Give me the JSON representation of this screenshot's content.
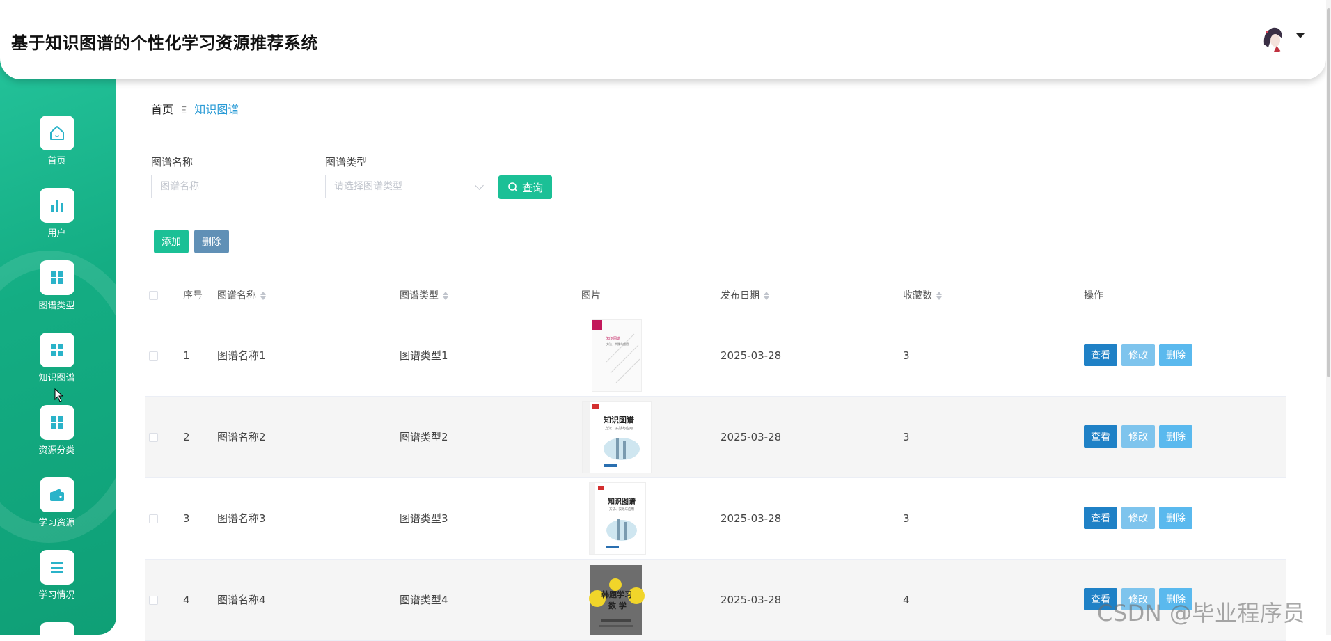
{
  "app": {
    "title": "基于知识图谱的个性化学习资源推荐系统"
  },
  "sidebar": {
    "items": [
      {
        "label": "首页",
        "icon": "home-icon"
      },
      {
        "label": "用户",
        "icon": "bar-chart-icon"
      },
      {
        "label": "图谱类型",
        "icon": "grid-icon"
      },
      {
        "label": "知识图谱",
        "icon": "grid-icon"
      },
      {
        "label": "资源分类",
        "icon": "grid-icon"
      },
      {
        "label": "学习资源",
        "icon": "wallet-icon"
      },
      {
        "label": "学习情况",
        "icon": "list-icon"
      }
    ]
  },
  "breadcrumb": {
    "home": "首页",
    "separator": "Ξ",
    "current": "知识图谱"
  },
  "filters": {
    "name_label": "图谱名称",
    "name_placeholder": "图谱名称",
    "type_label": "图谱类型",
    "type_placeholder": "请选择图谱类型",
    "query_label": "查询"
  },
  "toolbar": {
    "add_label": "添加",
    "delete_label": "删除"
  },
  "table": {
    "columns": {
      "index": "序号",
      "name": "图谱名称",
      "type": "图谱类型",
      "image": "图片",
      "date": "发布日期",
      "favorites": "收藏数",
      "actions": "操作"
    },
    "actions": {
      "view": "查看",
      "edit": "修改",
      "delete": "删除"
    },
    "rows": [
      {
        "index": "1",
        "name": "图谱名称1",
        "type": "图谱类型1",
        "date": "2025-03-28",
        "favorites": "3",
        "cover": "knowledge-graph-book-cover"
      },
      {
        "index": "2",
        "name": "图谱名称2",
        "type": "图谱类型2",
        "date": "2025-03-28",
        "favorites": "3",
        "cover": "knowledge-graph-book-cover"
      },
      {
        "index": "3",
        "name": "图谱名称3",
        "type": "图谱类型3",
        "date": "2025-03-28",
        "favorites": "3",
        "cover": "knowledge-graph-book-cover"
      },
      {
        "index": "4",
        "name": "图谱名称4",
        "type": "图谱类型4",
        "date": "2025-03-28",
        "favorites": "4",
        "cover": "math-book-cover"
      }
    ]
  },
  "covers": {
    "cover_1_lines": [
      "知识图谱",
      "方法、实践与应用"
    ],
    "cover_2_lines": [
      "知识图谱",
      "方法、实践与应用"
    ],
    "cover_3_lines": [
      "知识图谱",
      "方法、实践与应用"
    ],
    "cover_4_lines": [
      "韩题学习",
      "数 学"
    ]
  },
  "watermark": "CSDN @毕业程序员",
  "colors": {
    "sidebar": "#14ad83",
    "primary": "#1bc096",
    "delete_toolbar": "#6090b6",
    "view": "#1f81c6",
    "edit": "#7ec4ed",
    "delete": "#5ab9ee",
    "breadcrumb_active": "#2a9bd6"
  }
}
